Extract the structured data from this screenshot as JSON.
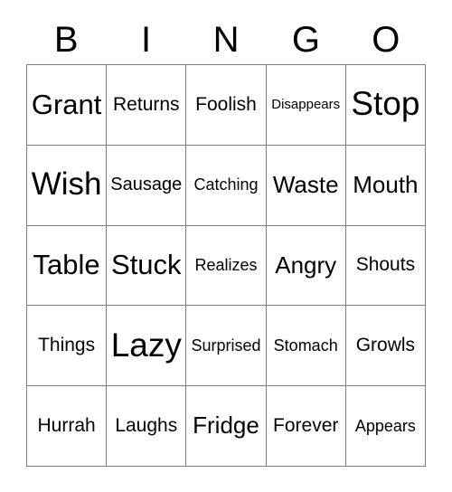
{
  "card": {
    "header": {
      "letters": [
        "B",
        "I",
        "N",
        "G",
        "O"
      ]
    },
    "grid": {
      "rows": 5,
      "columns": 5,
      "border_color": "#808080",
      "background_color": "#ffffff",
      "text_color": "#000000",
      "cells": [
        [
          {
            "label": "Grant",
            "size": "lg"
          },
          {
            "label": "Returns",
            "size": "sm"
          },
          {
            "label": "Foolish",
            "size": "sm"
          },
          {
            "label": "Disappears",
            "size": "xxs"
          },
          {
            "label": "Stop",
            "size": "xl"
          }
        ],
        [
          {
            "label": "Wish",
            "size": "xl"
          },
          {
            "label": "Sausage",
            "size": "sm"
          },
          {
            "label": "Catching",
            "size": "xs"
          },
          {
            "label": "Waste",
            "size": "md"
          },
          {
            "label": "Mouth",
            "size": "md"
          }
        ],
        [
          {
            "label": "Table",
            "size": "lg"
          },
          {
            "label": "Stuck",
            "size": "lg"
          },
          {
            "label": "Realizes",
            "size": "xs"
          },
          {
            "label": "Angry",
            "size": "md"
          },
          {
            "label": "Shouts",
            "size": "sm"
          }
        ],
        [
          {
            "label": "Things",
            "size": "sm"
          },
          {
            "label": "Lazy",
            "size": "xl"
          },
          {
            "label": "Surprised",
            "size": "xs"
          },
          {
            "label": "Stomach",
            "size": "xs"
          },
          {
            "label": "Growls",
            "size": "sm"
          }
        ],
        [
          {
            "label": "Hurrah",
            "size": "sm"
          },
          {
            "label": "Laughs",
            "size": "sm"
          },
          {
            "label": "Fridge",
            "size": "md"
          },
          {
            "label": "Forever",
            "size": "sm"
          },
          {
            "label": "Appears",
            "size": "xs"
          }
        ]
      ]
    }
  }
}
